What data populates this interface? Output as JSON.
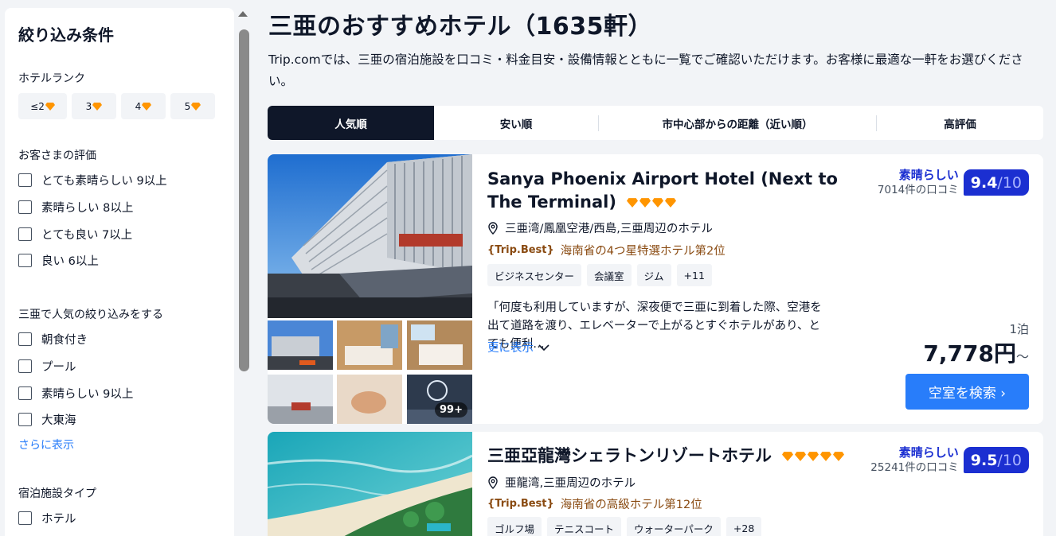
{
  "sidebar": {
    "title": "絞り込み条件",
    "hotel_rank": {
      "label": "ホテルランク",
      "options": [
        "≤2",
        "3",
        "4",
        "5"
      ]
    },
    "guest_rating": {
      "label": "お客さまの評価",
      "options": [
        "とても素晴らしい 9以上",
        "素晴らしい 8以上",
        "とても良い 7以上",
        "良い 6以上"
      ]
    },
    "popular": {
      "label": "三亜で人気の絞り込みをする",
      "options": [
        "朝食付き",
        "プール",
        "素晴らしい 9以上",
        "大東海"
      ],
      "more": "さらに表示"
    },
    "property_type": {
      "label": "宿泊施設タイプ",
      "options": [
        "ホテル"
      ]
    }
  },
  "header": {
    "title": "三亜のおすすめホテル（1635軒）",
    "description": "Trip.comでは、三亜の宿泊施設を口コミ・料金目安・設備情報とともに一覧でご確認いただけます。お客様に最適な一軒をお選びください。"
  },
  "sort": {
    "tabs": [
      "人気順",
      "安い順",
      "市中心部からの距離（近い順）",
      "高評価"
    ],
    "active": "人気順"
  },
  "hotels": [
    {
      "name": "Sanya Phoenix Airport Hotel (Next to The Terminal)",
      "stars": 4,
      "location": "三亜湾/鳳凰空港/西島,三亜周辺のホテル",
      "trip_best_badge": "Trip.Best",
      "trip_best_text": "海南省の4つ星特選ホテル第2位",
      "tags": [
        "ビジネスセンター",
        "会議室",
        "ジム",
        "+11"
      ],
      "review": "「何度も利用していますが、深夜便で三亜に到着した際、空港を出て道路を渡り、エレベーターで上がるとすぐホテルがあり、とても便利…",
      "show_more": "更に表示",
      "rating_word": "素晴らしい",
      "review_count": "7014件の口コミ",
      "score": "9.4",
      "score_den": "/10",
      "per_night": "1泊",
      "price": "7,778円",
      "price_suffix": "～",
      "cta": "空室を検索 ›",
      "photo_count": "99+"
    },
    {
      "name": "三亜亞龍灣シェラトンリゾートホテル",
      "stars": 5,
      "location": "亜龍湾,三亜周辺のホテル",
      "trip_best_badge": "Trip.Best",
      "trip_best_text": "海南省の高級ホテル第12位",
      "tags": [
        "ゴルフ場",
        "テニスコート",
        "ウォーターパーク",
        "+28"
      ],
      "rating_word": "素晴らしい",
      "review_count": "25241件の口コミ",
      "score": "9.5",
      "score_den": "/10"
    }
  ],
  "colors": {
    "accent": "#287dfa",
    "score_bg": "#1b2fd1",
    "gem": "#ff9500",
    "trip_best": "#8a4b12",
    "dark": "#0f1729"
  }
}
